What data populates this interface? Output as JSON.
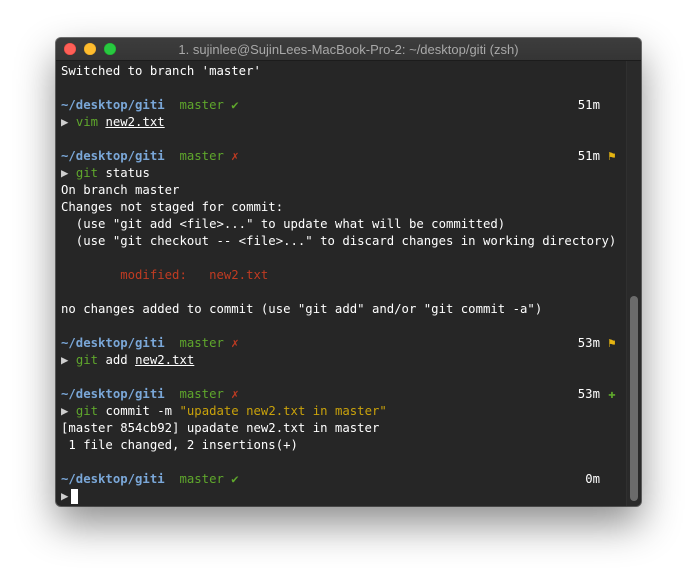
{
  "window": {
    "title": "1. sujinlee@SujinLees-MacBook-Pro-2: ~/desktop/giti (zsh)"
  },
  "prompt": {
    "path": "~/desktop/giti",
    "branch": "master",
    "symbol": "▶"
  },
  "lines": {
    "switched": "Switched to branch 'master'",
    "p1": {
      "status": "✔",
      "time": "51m",
      "cmd": "vim",
      "arg": "new2.txt"
    },
    "p2": {
      "status": "✗",
      "time": "51m",
      "flag": "⚑",
      "cmd": "git",
      "arg": "status"
    },
    "status_out": [
      "On branch master",
      "Changes not staged for commit:",
      "  (use \"git add <file>...\" to update what will be committed)",
      "  (use \"git checkout -- <file>...\" to discard changes in working directory)"
    ],
    "modified_label": "        modified:   new2.txt",
    "no_changes": "no changes added to commit (use \"git add\" and/or \"git commit -a\")",
    "p3": {
      "status": "✗",
      "time": "53m",
      "flag": "⚑",
      "cmd": "git",
      "sub": "add",
      "arg": "new2.txt"
    },
    "p4": {
      "status": "✗",
      "time": "53m",
      "flag": "✚",
      "cmd": "git",
      "sub": "commit -m",
      "msg": "\"upadate new2.txt in master\""
    },
    "commit_out": [
      "[master 854cb92] upadate new2.txt in master",
      " 1 file changed, 2 insertions(+)"
    ],
    "p5": {
      "status": "✔",
      "time": "0m"
    }
  },
  "colors": {
    "background": "#262626",
    "path": "#7aa7d8",
    "branch": "#5fa72c",
    "dirty": "#c03b22",
    "string": "#c9a20b",
    "flag": "#e5b411"
  }
}
